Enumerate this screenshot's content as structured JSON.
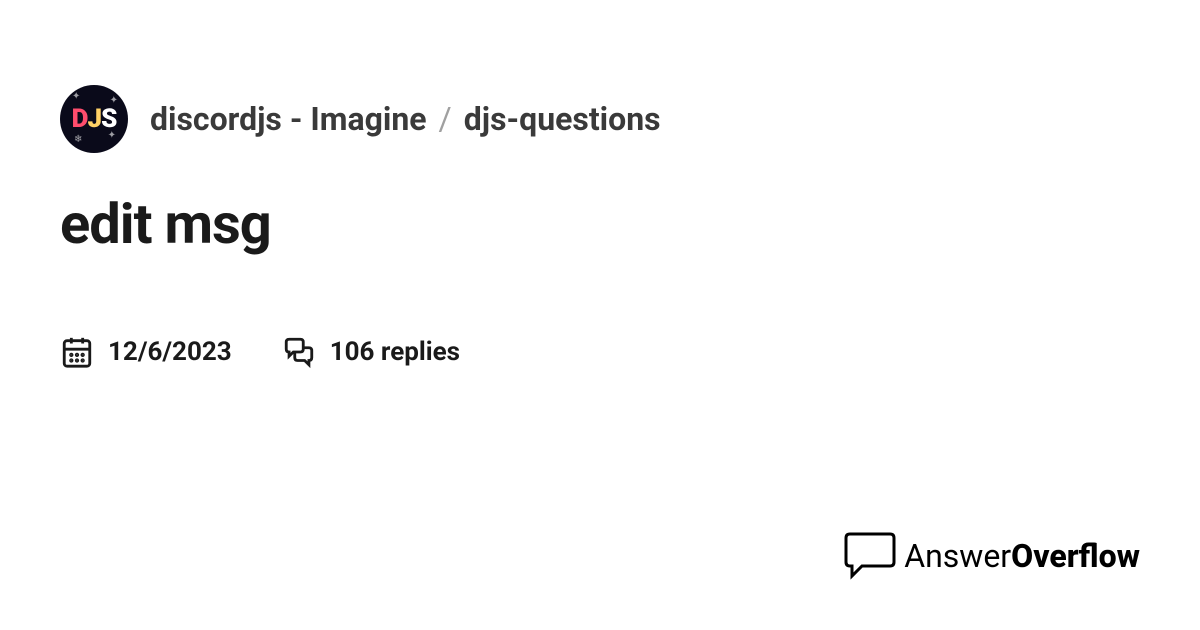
{
  "header": {
    "avatar_text": "DJS",
    "server_name": "discordjs - Imagine",
    "separator": "/",
    "channel_name": "djs-questions"
  },
  "post": {
    "title": "edit msg",
    "date": "12/6/2023",
    "replies": "106 replies"
  },
  "brand": {
    "answer": "Answer",
    "overflow": "Overflow"
  }
}
